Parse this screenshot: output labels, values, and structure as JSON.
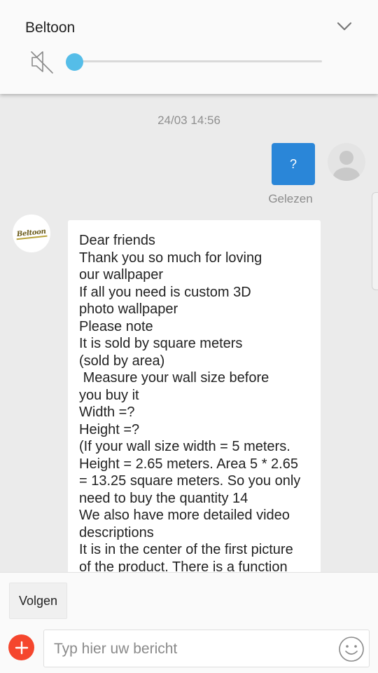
{
  "volume_panel": {
    "title": "Beltoon",
    "level": 0.0,
    "muted": true,
    "icons": {
      "mute": "speaker-muted-icon",
      "collapse": "chevron-down-icon"
    },
    "accent_color": "#55bde8"
  },
  "chat": {
    "timestamp": "24/03 14:56",
    "sent_message": {
      "text": "?",
      "status": "Gelezen",
      "bubble_color": "#2a86d8"
    },
    "received_message": {
      "sender_logo_text": "Beltoon",
      "text": "Dear friends\nThank you so much for loving\nour wallpaper\nIf all you need is custom 3D\nphoto wallpaper\nPlease note\nIt is sold by square meters\n(sold by area)\n Measure your wall size before\nyou buy it\nWidth =?\nHeight =?\n(If your wall size width = 5 meters.\nHeight = 2.65 meters. Area 5 * 2.65\n= 13.25 square meters. So you only\nneed to buy the quantity 14\nWe also have more detailed video\ndescriptions\nIt is in the center of the first picture\nof the product. There is a function"
    }
  },
  "bottom_bar": {
    "follow_label": "Volgen",
    "input_placeholder": "Typ hier uw bericht",
    "icons": {
      "add": "plus-icon",
      "emoji": "smiley-icon"
    },
    "add_button_color": "#f5462d"
  }
}
